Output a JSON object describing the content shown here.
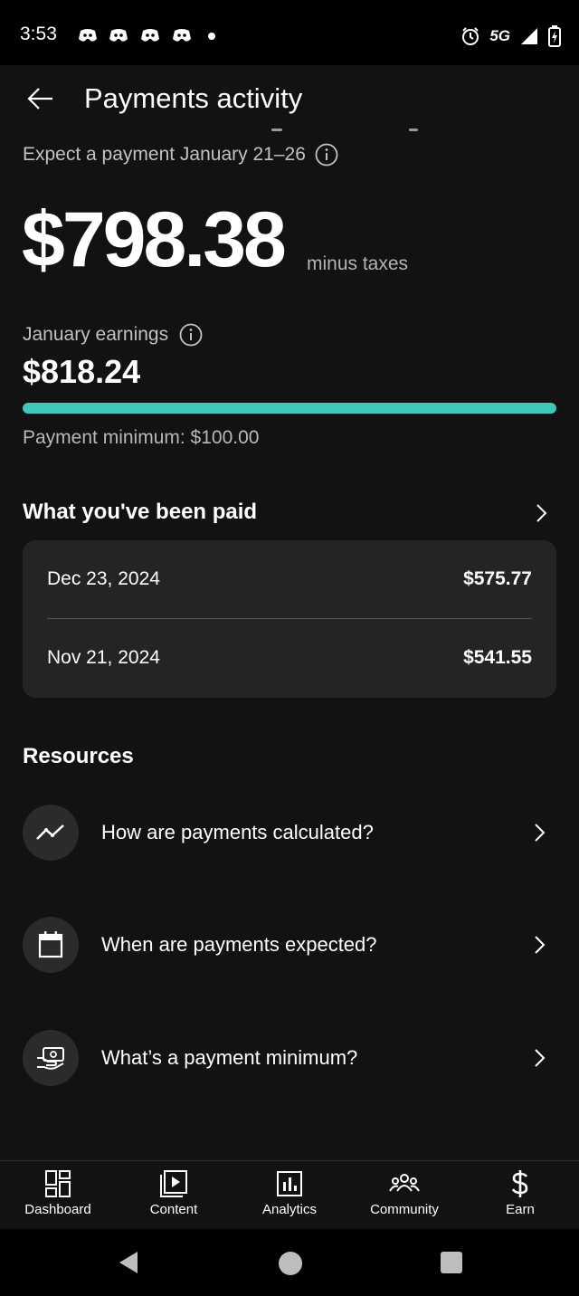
{
  "status_bar": {
    "time": "3:53",
    "network": "5G",
    "icons": [
      "discord-icon",
      "discord-icon",
      "discord-icon",
      "discord-icon",
      "dot",
      "alarm-icon",
      "signal-icon",
      "battery-charging-icon"
    ]
  },
  "header": {
    "title": "Payments activity",
    "back_icon": "arrow-left-icon"
  },
  "summary": {
    "expect_text": "Expect a payment January 21–26",
    "amount": "$798.38",
    "amount_suffix": "minus taxes"
  },
  "earnings": {
    "label": "January earnings",
    "amount": "$818.24",
    "progress_percent": 100,
    "minimum_text": "Payment minimum: $100.00"
  },
  "paid": {
    "title": "What you've been paid",
    "rows": [
      {
        "date": "Dec 23, 2024",
        "amount": "$575.77"
      },
      {
        "date": "Nov 21, 2024",
        "amount": "$541.55"
      }
    ]
  },
  "resources": {
    "title": "Resources",
    "items": [
      {
        "label": "How are payments calculated?",
        "icon": "trend-line-icon"
      },
      {
        "label": "When are payments expected?",
        "icon": "calendar-icon"
      },
      {
        "label": "What’s a payment minimum?",
        "icon": "cash-icon"
      }
    ]
  },
  "bottom_nav": {
    "items": [
      {
        "label": "Dashboard",
        "icon": "dashboard-icon"
      },
      {
        "label": "Content",
        "icon": "play-icon"
      },
      {
        "label": "Analytics",
        "icon": "analytics-icon"
      },
      {
        "label": "Community",
        "icon": "community-icon"
      },
      {
        "label": "Earn",
        "icon": "dollar-icon"
      }
    ]
  },
  "colors": {
    "background": "#121212",
    "card": "#242424",
    "accent": "#3ec9bb",
    "secondary_text": "#c2c2c2"
  }
}
